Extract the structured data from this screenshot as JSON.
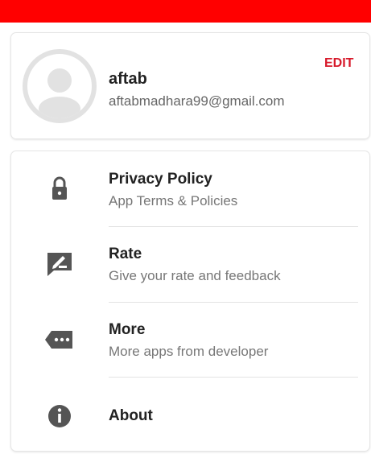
{
  "status_bar": {
    "color": "#ff0000"
  },
  "profile": {
    "avatar_icon": "person-placeholder-icon",
    "name": "aftab",
    "email": "aftabmadhara99@gmail.com",
    "edit_label": "EDIT"
  },
  "menu": {
    "items": [
      {
        "icon": "lock-icon",
        "title": "Privacy Policy",
        "subtitle": "App Terms & Policies"
      },
      {
        "icon": "rate-review-icon",
        "title": "Rate",
        "subtitle": "Give your rate and feedback"
      },
      {
        "icon": "more-label-icon",
        "title": "More",
        "subtitle": "More apps from developer"
      },
      {
        "icon": "info-icon",
        "title": "About",
        "subtitle": ""
      }
    ]
  },
  "colors": {
    "accent": "#d7192a",
    "icon": "#555555"
  }
}
